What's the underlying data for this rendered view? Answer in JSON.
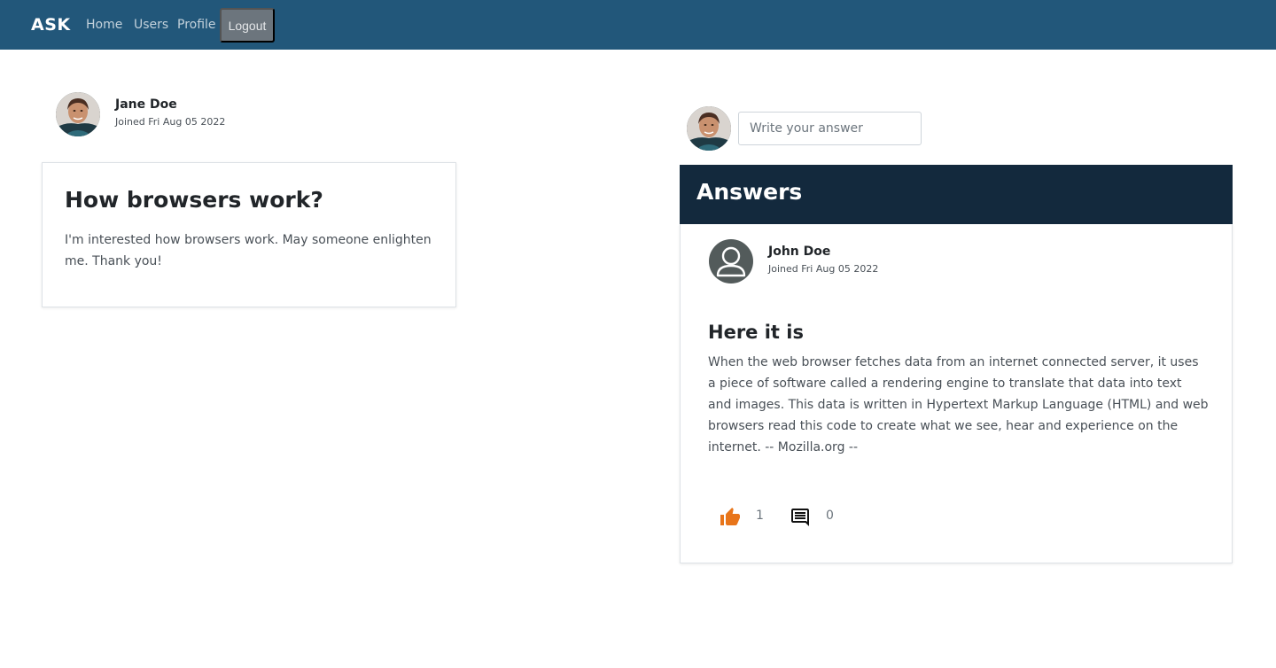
{
  "navbar": {
    "brand": "ASK",
    "links": [
      "Home",
      "Users",
      "Profile"
    ],
    "logout_label": "Logout",
    "background": "#22577a"
  },
  "question": {
    "author": {
      "name": "Jane Doe",
      "joined": "Joined Fri Aug 05 2022"
    },
    "title": "How browsers work?",
    "body": "I'm interested how browsers work. May someone enlighten me. Thank you!"
  },
  "answer_form": {
    "placeholder": "Write your answer",
    "value": ""
  },
  "answers": {
    "header": "Answers",
    "header_color": "#13293d",
    "items": [
      {
        "author": {
          "name": "John Doe",
          "joined": "Joined Fri Aug 05 2022"
        },
        "title": "Here it is",
        "body": "When the web browser fetches data from an internet connected server, it uses a piece of software called a rendering engine to translate that data into text and images. This data is written in Hypertext Markup Language (HTML) and web browsers read this code to create what we see, hear and experience on the internet. -- Mozilla.org --",
        "likes": "1",
        "comments": "0",
        "like_icon": "thumbs-up-icon",
        "like_color": "#e8751a",
        "comment_icon": "comment-icon"
      }
    ]
  }
}
